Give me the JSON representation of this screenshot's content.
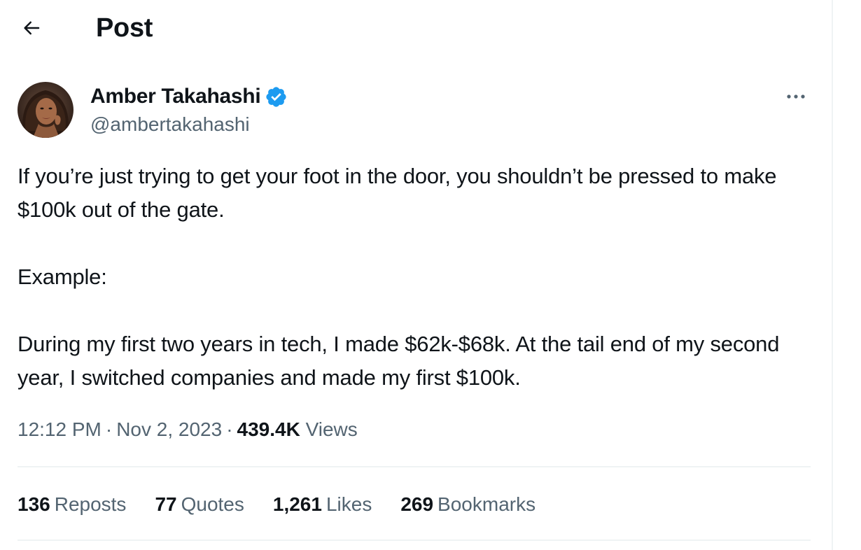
{
  "header": {
    "title": "Post",
    "back_icon": "arrow-left-icon"
  },
  "author": {
    "name": "Amber Takahashi",
    "handle": "@ambertakahashi",
    "verified": true,
    "verified_color": "#1d9bf0"
  },
  "post": {
    "paragraphs": [
      "If you’re just trying to get your foot in the door, you shouldn’t be pressed to make $100k out of the gate.",
      "Example:",
      "During my first two years in tech, I made $62k-$68k. At the tail end of my second year, I switched companies and made my first $100k."
    ]
  },
  "meta": {
    "time": "12:12 PM",
    "separator": "·",
    "date": "Nov 2, 2023",
    "views_count": "439.4K",
    "views_label": "Views"
  },
  "stats": {
    "reposts_count": "136",
    "reposts_label": "Reposts",
    "quotes_count": "77",
    "quotes_label": "Quotes",
    "likes_count": "1,261",
    "likes_label": "Likes",
    "bookmarks_count": "269",
    "bookmarks_label": "Bookmarks"
  },
  "colors": {
    "text_primary": "#0f1419",
    "text_secondary": "#536471",
    "divider": "#eff3f4"
  }
}
